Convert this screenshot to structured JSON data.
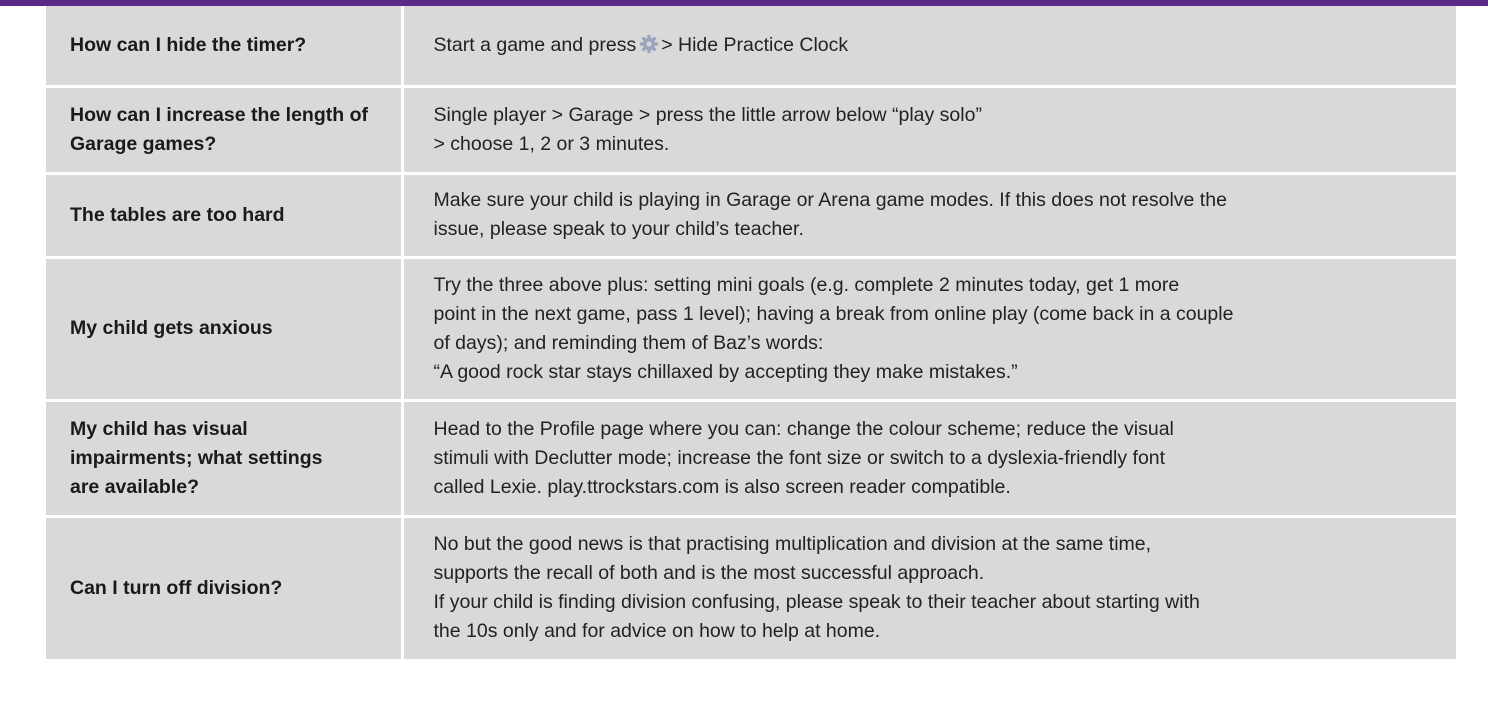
{
  "colors": {
    "accent_bar": "#5b2a86",
    "row_background": "#d9d9d9",
    "gear_icon": "#9aa6bd"
  },
  "faq": [
    {
      "question": [
        "How can I hide the timer?"
      ],
      "answer": {
        "before_icon": "Start a game and press",
        "icon": "gear-icon",
        "after_icon": "> Hide Practice Clock"
      }
    },
    {
      "question": [
        "How can I increase the length of",
        "Garage games?"
      ],
      "answer": {
        "lines": [
          "Single player > Garage > press the little arrow below “play solo”",
          "> choose 1, 2 or 3 minutes."
        ]
      }
    },
    {
      "question": [
        "The tables are too hard"
      ],
      "answer": {
        "lines": [
          "Make sure your child is playing in Garage or Arena game modes. If this does not resolve the",
          "issue, please speak to your child’s teacher."
        ]
      }
    },
    {
      "question": [
        "My child gets anxious"
      ],
      "answer": {
        "lines": [
          "Try the three above plus: setting mini goals (e.g. complete 2 minutes today, get 1 more",
          "point in the next game, pass 1 level); having a break from online play (come back in a couple",
          "of days); and reminding them of Baz’s words:",
          "“A good rock star stays chillaxed by accepting they make mistakes.”"
        ]
      }
    },
    {
      "question": [
        "My child has visual",
        "impairments; what settings",
        "are available?"
      ],
      "answer": {
        "lines": [
          "Head to the Profile page where you can: change the colour scheme; reduce the visual",
          "stimuli with Declutter mode; increase the font size or switch to a dyslexia-friendly font",
          "called Lexie.  play.ttrockstars.com is also screen reader compatible."
        ]
      }
    },
    {
      "question": [
        "Can I turn off division?"
      ],
      "answer": {
        "lines": [
          "No but the good news is that practising multiplication and division at the same time,",
          "supports the recall of both and is the most successful approach.",
          "If your child is finding division confusing, please speak to their teacher about starting with",
          "the 10s only and for advice on how to help at home."
        ]
      }
    }
  ]
}
